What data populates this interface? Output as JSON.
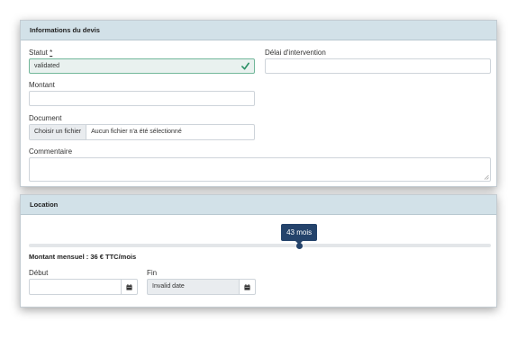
{
  "devis": {
    "header": "Informations du devis",
    "statut": {
      "label": "Statut ",
      "required_mark": "*",
      "value": "validated"
    },
    "delai": {
      "label": "Délai d'intervention",
      "value": ""
    },
    "montant": {
      "label": "Montant",
      "value": ""
    },
    "document": {
      "label": "Document",
      "button_label": "Choisir un fichier",
      "status_text": "Aucun fichier n'a été sélectionné"
    },
    "commentaire": {
      "label": "Commentaire",
      "value": ""
    }
  },
  "location": {
    "header": "Location",
    "slider": {
      "value": 43,
      "value_label": "43 mois",
      "position_fraction": 0.585
    },
    "mensuel_text": "Montant mensuel : 36 € TTC/mois",
    "debut": {
      "label": "Début",
      "value": ""
    },
    "fin": {
      "label": "Fin",
      "value": "Invalid date"
    }
  },
  "colors": {
    "header_bg": "#d2e1e8",
    "accent": "#24436b",
    "valid_border": "#72b79a",
    "valid_check": "#2c9066"
  },
  "icons": {
    "valid": "check-icon",
    "calendar": "calendar-icon",
    "resize": "resize-handle-icon"
  }
}
